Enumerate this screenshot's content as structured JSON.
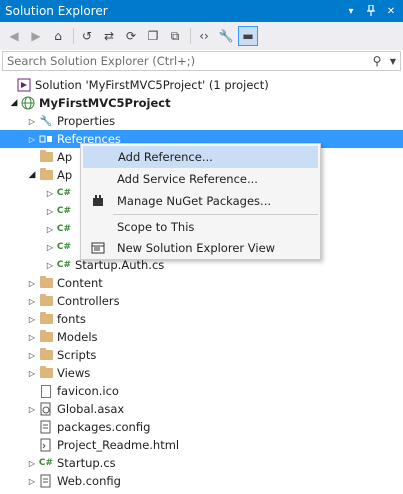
{
  "window": {
    "title": "Solution Explorer",
    "pin_icon": "pin-icon",
    "close_icon": "close-icon",
    "dropdown_icon": "chevron-down-icon"
  },
  "toolbar": {
    "icons": [
      "back-icon",
      "forward-icon",
      "home-icon",
      "history-icon",
      "sync-icon",
      "refresh-icon",
      "collapse-all-icon",
      "show-all-files-icon",
      "view-code-icon",
      "properties-icon",
      "preview-icon"
    ]
  },
  "search": {
    "placeholder": "Search Solution Explorer (Ctrl+;)"
  },
  "tree": {
    "solution": "Solution 'MyFirstMVC5Project' (1 project)",
    "project": "MyFirstMVC5Project",
    "properties": "Properties",
    "references": "References",
    "app_data_partial": "Ap",
    "app_start_partial": "Ap",
    "startup_auth": "Startup.Auth.cs",
    "content": "Content",
    "controllers": "Controllers",
    "fonts": "fonts",
    "models": "Models",
    "scripts": "Scripts",
    "views": "Views",
    "favicon": "favicon.ico",
    "global": "Global.asax",
    "packages": "packages.config",
    "readme": "Project_Readme.html",
    "startup": "Startup.cs",
    "webconfig": "Web.config",
    "csharp_badge": "C#"
  },
  "context_menu": {
    "add_reference": "Add Reference...",
    "add_service_reference": "Add Service Reference...",
    "manage_nuget": "Manage NuGet Packages...",
    "scope_to_this": "Scope to This",
    "new_view": "New Solution Explorer View"
  }
}
